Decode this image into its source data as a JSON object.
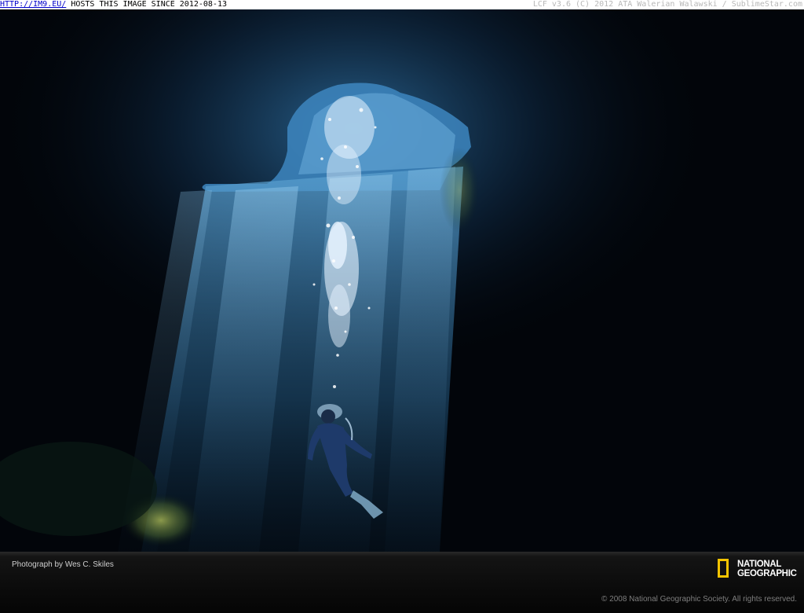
{
  "hostbar": {
    "link": "HTTP://IM9.EU/",
    "hosting_text": " HOSTS THIS IMAGE SINCE 2012-08-13",
    "right_text": "LCF v3.6 (C) 2012 ATA Walerian Walawski / SublimeStar.com"
  },
  "caption": {
    "credit": "Photograph by Wes C. Skiles",
    "copyright": "© 2008 National Geographic Society. All rights reserved."
  },
  "logo": {
    "line1": "NATIONAL",
    "line2": "GEOGRAPHIC",
    "frame_color": "#f5c400"
  },
  "colors": {
    "water_dark": "#02050a",
    "light_beam": "#3f7fb0",
    "footer": "#0b0b0b"
  }
}
